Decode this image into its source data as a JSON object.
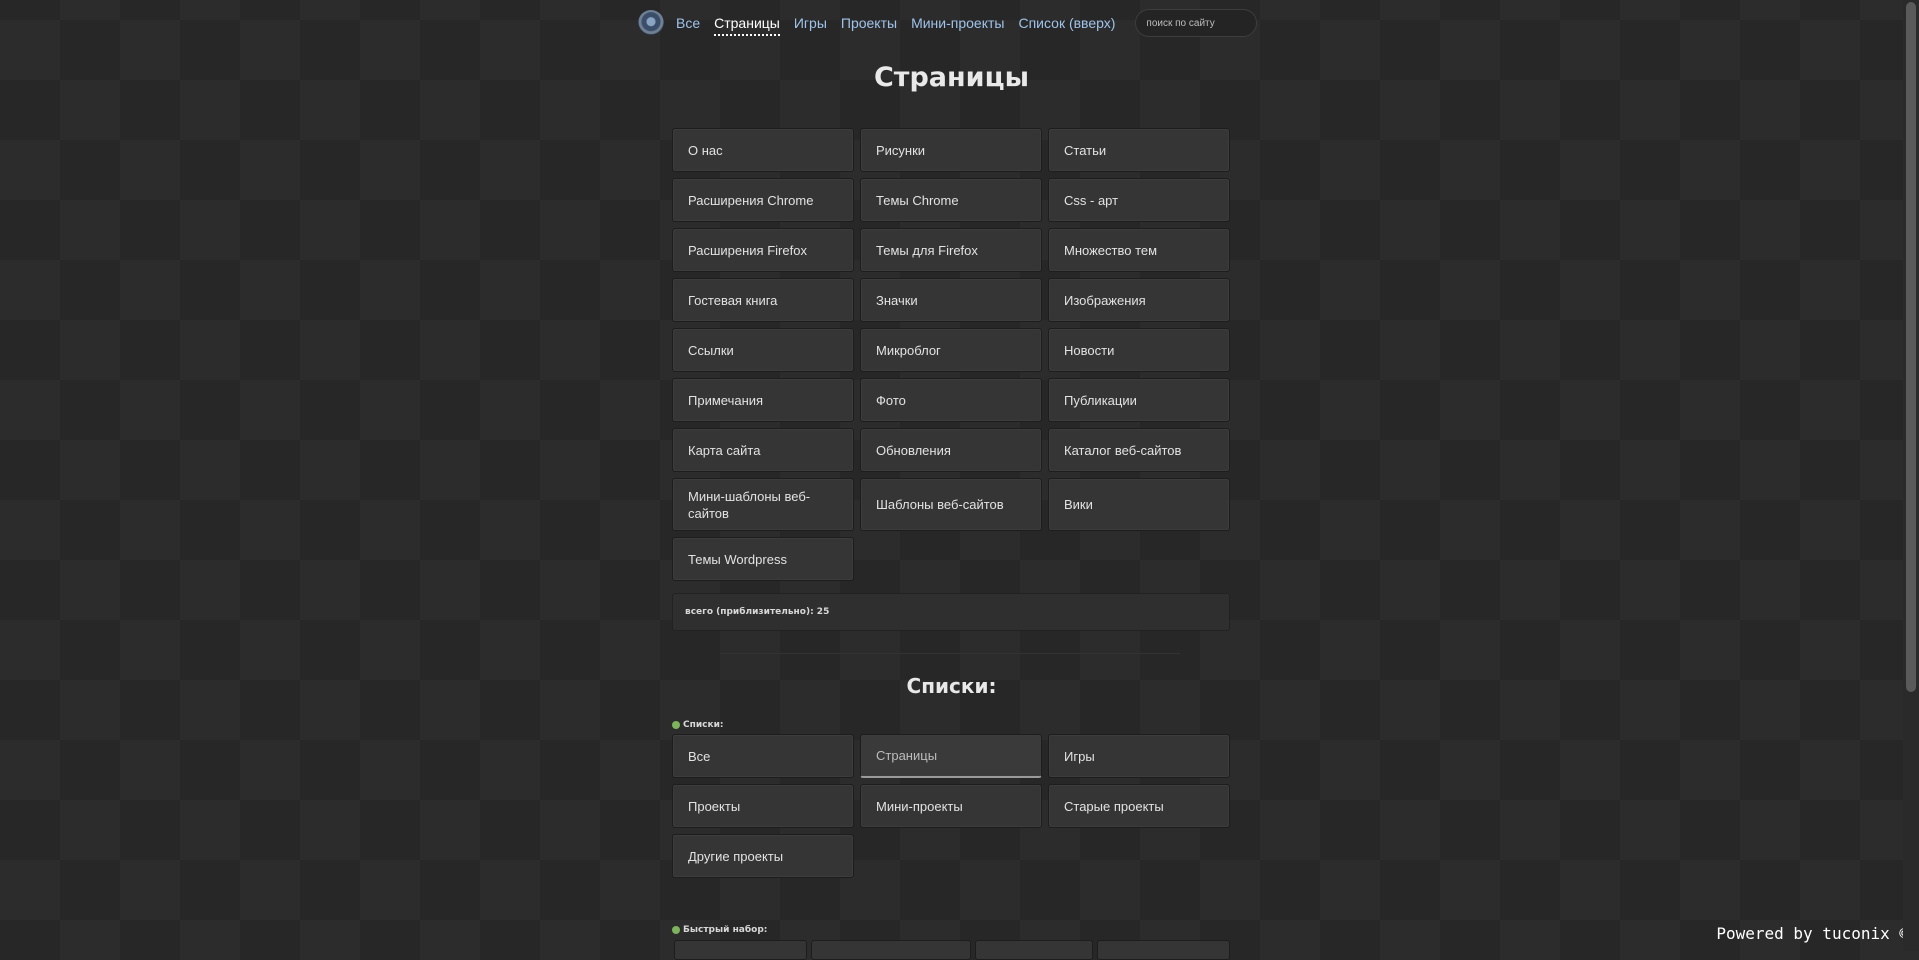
{
  "nav": {
    "items": [
      {
        "label": "Все",
        "active": false
      },
      {
        "label": "Страницы",
        "active": true
      },
      {
        "label": "Игры",
        "active": false
      },
      {
        "label": "Проекты",
        "active": false
      },
      {
        "label": "Мини-проекты",
        "active": false
      },
      {
        "label": "Список (вверх)",
        "active": false
      }
    ],
    "search_placeholder": "поиск по сайту"
  },
  "pages": {
    "title": "Страницы",
    "items": [
      "О нас",
      "Рисунки",
      "Статьи",
      "Расширения Chrome",
      "Темы Chrome",
      "Css - арт",
      "Расширения Firefox",
      "Темы для Firefox",
      "Множество тем",
      "Гостевая книга",
      "Значки",
      "Изображения",
      "Ссылки",
      "Микроблог",
      "Новости",
      "Примечания",
      "Фото",
      "Публикации",
      "Карта сайта",
      "Обновления",
      "Каталог веб-сайтов",
      "Мини-шаблоны веб-сайтов",
      "Шаблоны веб-сайтов",
      "Вики",
      "Темы Wordpress"
    ],
    "total": "всего (приблизительно): 25"
  },
  "lists": {
    "title": "Списки:",
    "label": "Списки:",
    "items": [
      "Все",
      "Страницы",
      "Игры",
      "Проекты",
      "Мини-проекты",
      "Старые проекты",
      "Другие проекты"
    ],
    "current": "Страницы",
    "quick_label": "Быстрый набор:"
  },
  "footer": {
    "powered": "Powered by tuconix ©"
  },
  "colors": {
    "background": "#272727",
    "card": "#353535",
    "link": "#9fc3ea",
    "accent_dot": "#7db35c"
  }
}
